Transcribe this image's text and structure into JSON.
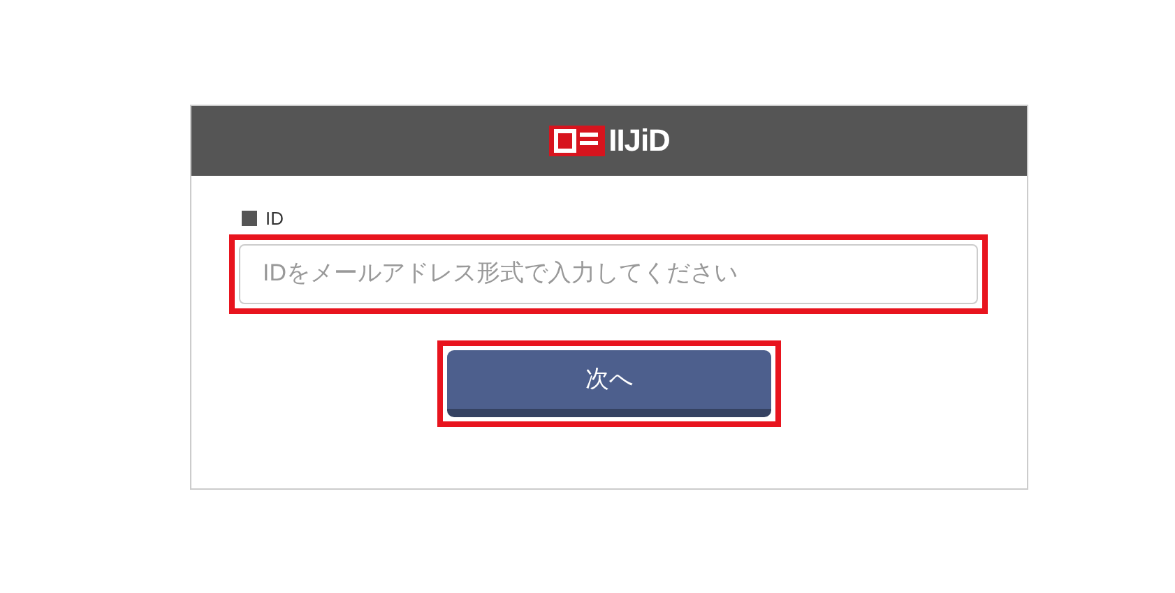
{
  "header": {
    "logo_text": "IIJiD"
  },
  "id_field": {
    "label": "ID",
    "placeholder": "IDをメールアドレス形式で入力してください",
    "highlighted": true
  },
  "next_button": {
    "label": "次へ",
    "highlighted": true
  }
}
